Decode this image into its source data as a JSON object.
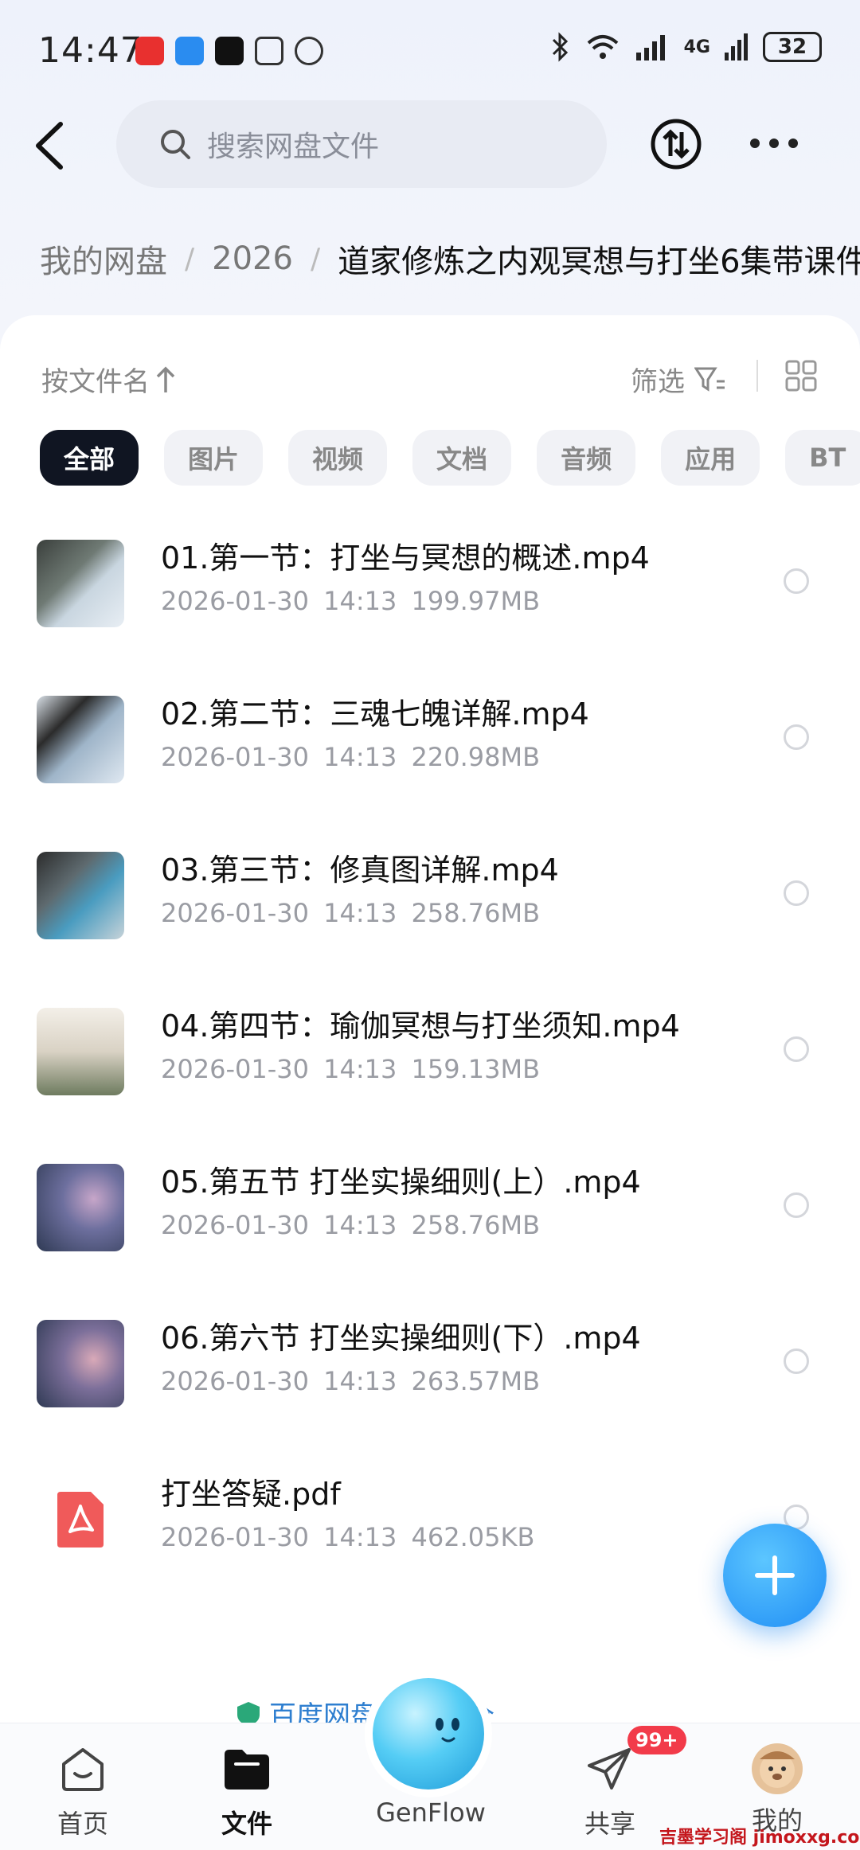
{
  "status_bar": {
    "time": "14:47",
    "battery": "32",
    "network": "4G"
  },
  "search": {
    "placeholder": "搜索网盘文件"
  },
  "breadcrumb": {
    "root": "我的网盘",
    "year": "2026",
    "current": "道家修炼之内观冥想与打坐6集带课件"
  },
  "sort": {
    "label": "按文件名",
    "filter_label": "筛选"
  },
  "chips": [
    "全部",
    "图片",
    "视频",
    "文档",
    "音频",
    "应用",
    "BT"
  ],
  "files": [
    {
      "name": "01.第一节：打坐与冥想的概述.mp4",
      "date": "2026-01-30",
      "time": "14:13",
      "size": "199.97MB",
      "thumb": "video"
    },
    {
      "name": "02.第二节：三魂七魄详解.mp4",
      "date": "2026-01-30",
      "time": "14:13",
      "size": "220.98MB",
      "thumb": "video"
    },
    {
      "name": "03.第三节：修真图详解.mp4",
      "date": "2026-01-30",
      "time": "14:13",
      "size": "258.76MB",
      "thumb": "video"
    },
    {
      "name": "04.第四节：瑜伽冥想与打坐须知.mp4",
      "date": "2026-01-30",
      "time": "14:13",
      "size": "159.13MB",
      "thumb": "doc"
    },
    {
      "name": "05.第五节 打坐实操细则(上）.mp4",
      "date": "2026-01-30",
      "time": "14:13",
      "size": "258.76MB",
      "thumb": "art"
    },
    {
      "name": "06.第六节 打坐实操细则(下）.mp4",
      "date": "2026-01-30",
      "time": "14:13",
      "size": "263.57MB",
      "thumb": "art"
    },
    {
      "name": "打坐答疑.pdf",
      "date": "2026-01-30",
      "time": "14:13",
      "size": "462.05KB",
      "thumb": "pdf"
    }
  ],
  "notice": "百度网盘 数据安全",
  "nav": {
    "home": "首页",
    "files": "文件",
    "genflow": "GenFlow",
    "share": "共享",
    "share_badge": "99+",
    "me": "我的"
  },
  "watermark": "吉墨学习阁 jimoxxg.com",
  "colors": {
    "accent": "#1f8df5",
    "chip_active": "#101522",
    "badge": "#f23b4a",
    "pdf": "#f05a5a"
  }
}
